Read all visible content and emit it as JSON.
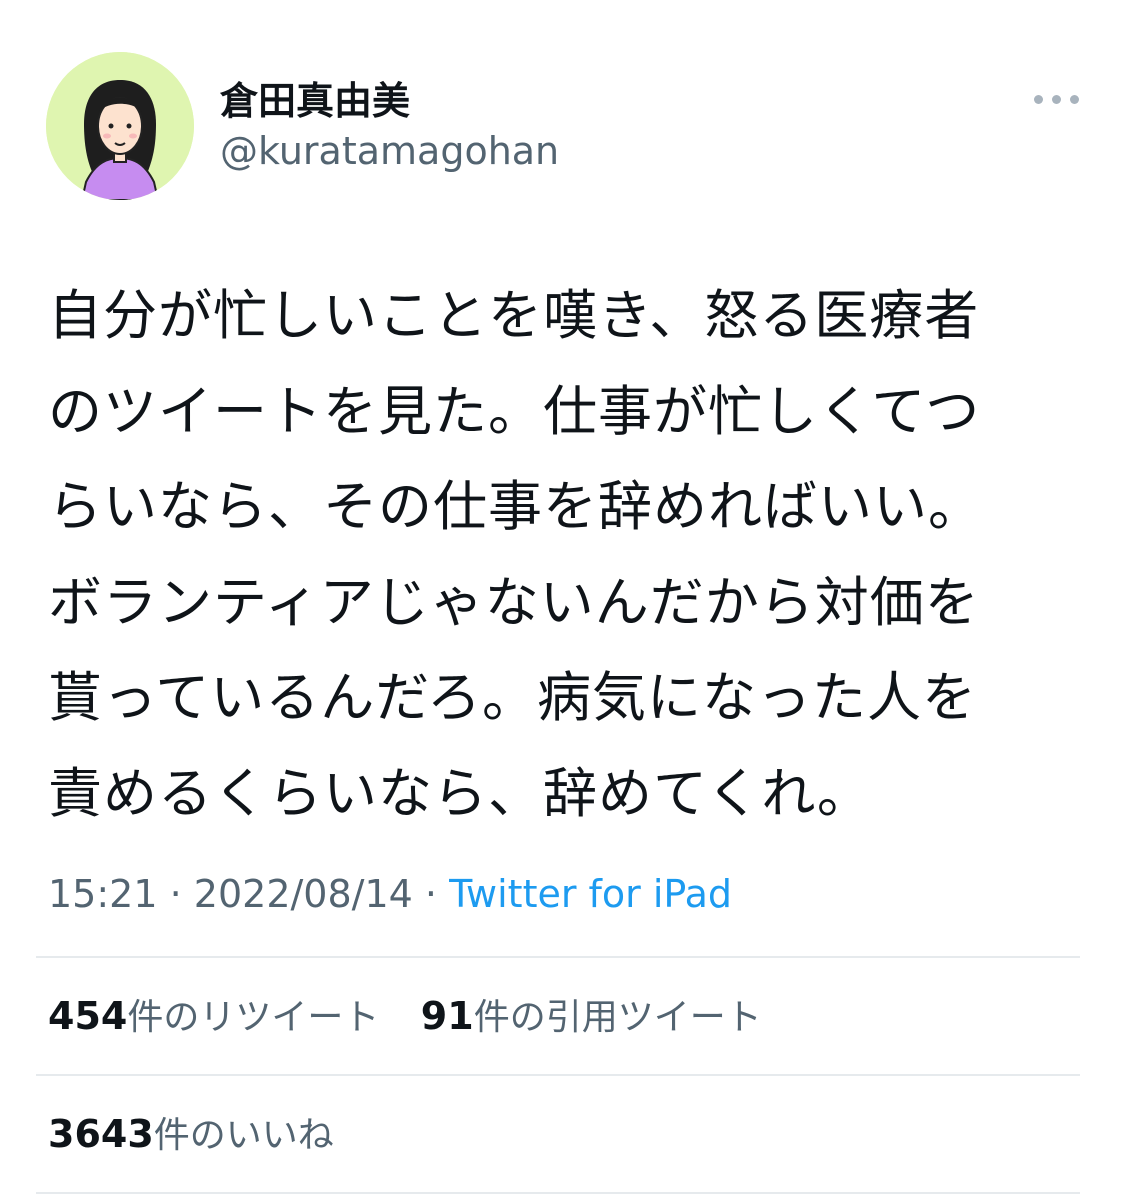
{
  "tweet": {
    "display_name": "倉田真由美",
    "handle": "@kuratamagohan",
    "text_lines": [
      "自分が忙しいことを嘆き、怒る医療者",
      "のツイートを見た。仕事が忙しくてつ",
      "らいなら、その仕事を辞めればいい。",
      "ボランティアじゃないんだから対価を",
      "貰っているんだろ。病気になった人を",
      "責めるくらいなら、辞めてくれ。"
    ],
    "time": "15:21",
    "date": "2022/08/14",
    "separator": "·",
    "source": "Twitter for iPad",
    "retweets": {
      "count": "454",
      "label": "件のリツイート"
    },
    "quotes": {
      "count": "91",
      "label": "件の引用ツイート"
    },
    "likes": {
      "count": "3643",
      "label": "件のいいね"
    }
  },
  "icons": {
    "avatar": "avatar-illustration",
    "more": "more-options-icon"
  },
  "colors": {
    "text": "#0f1419",
    "secondary": "#536471",
    "link": "#1d9bf0",
    "divider": "#e6eaed",
    "avatar_bg": "#dff5b0"
  }
}
